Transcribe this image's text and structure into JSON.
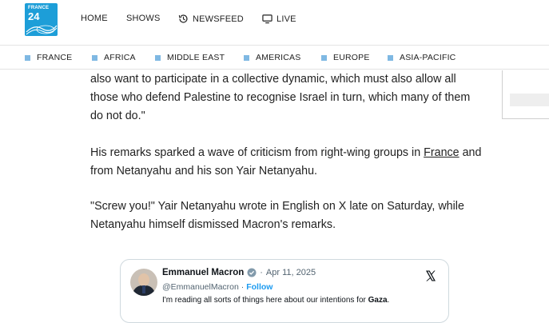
{
  "brand": {
    "logo_top": "FRANCE",
    "logo_bottom": "24",
    "accent": "#1d9ed8"
  },
  "main_nav": [
    {
      "label": "HOME",
      "icon": ""
    },
    {
      "label": "SHOWS",
      "icon": ""
    },
    {
      "label": "NEWSFEED",
      "icon": "history-icon"
    },
    {
      "label": "LIVE",
      "icon": "tv-icon"
    }
  ],
  "categories": [
    "FRANCE",
    "AFRICA",
    "MIDDLE EAST",
    "AMERICAS",
    "EUROPE",
    "ASIA-PACIFIC"
  ],
  "article": {
    "p1": "also want to participate in a collective dynamic, which must also allow all those who defend Palestine to recognise Israel in turn, which many of them do not do.\"",
    "p2_before": "His remarks sparked a wave of criticism from right-wing groups in ",
    "p2_link": "France",
    "p2_after": " and from Netanyahu and his son Yair Netanyahu.",
    "p3": "\"Screw you!\" Yair Netanyahu wrote in English on X late on Saturday, while Netanyahu himself dismissed Macron's remarks."
  },
  "tweet": {
    "name": "Emmanuel Macron",
    "separator": "·",
    "date": "Apr 11, 2025",
    "handle": "@EmmanuelMacron",
    "follow": "Follow",
    "text_start": "I'm reading all sorts of things here about our intentions for ",
    "text_bold": "Gaza",
    "text_end": ".",
    "platform_icon": "x-logo-icon"
  }
}
